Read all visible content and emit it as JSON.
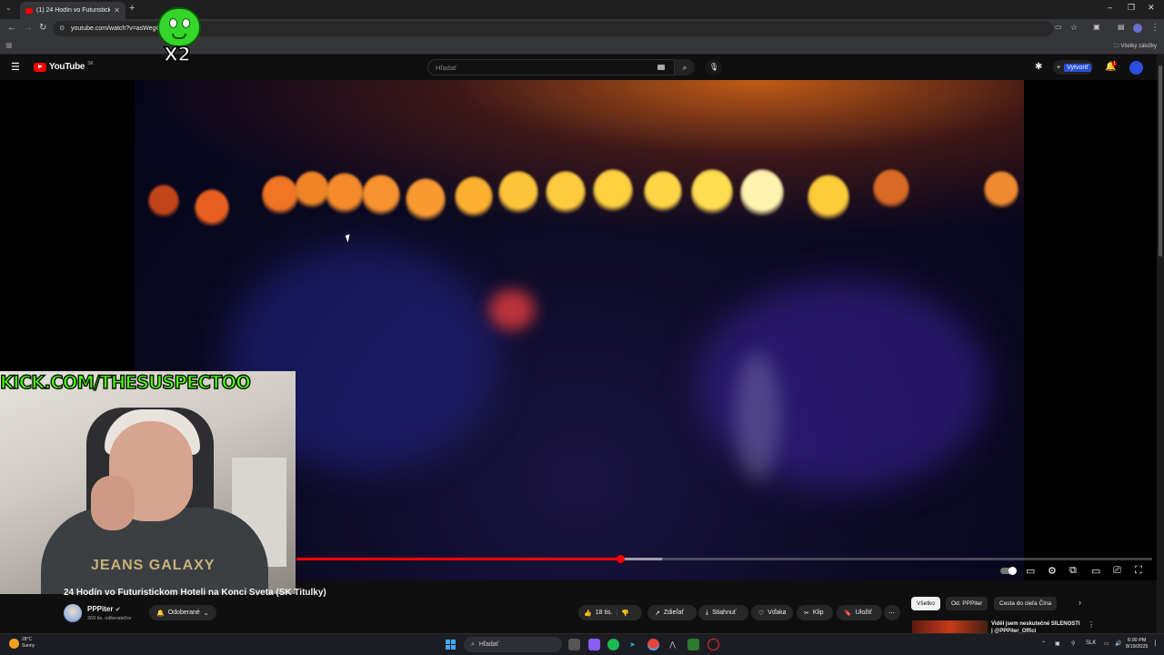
{
  "browser": {
    "tab_title": "(1) 24 Hodín vo Futuristickom H",
    "url": "youtube.com/watch?v=asWegG",
    "bookmarks_label": "Všetky záložky"
  },
  "youtube": {
    "logo_text": "YouTube",
    "country_code": "SK",
    "search_placeholder": "Hľadať",
    "create_label": "Vytvoriť",
    "notif_count": "1"
  },
  "overlay": {
    "kick_text": "KICK.COM/THESUSPECTOO",
    "multiplier": "X2",
    "shirt_text": "JEANS GALAXY"
  },
  "player": {
    "progress_fraction": 0.378,
    "buffered_fraction": 0.427
  },
  "video": {
    "title": "24 Hodín vo Futuristickom Hoteli na Konci Sveta (SK Titulky)",
    "channel_name": "PPPiter",
    "verified_icon": "verified-icon",
    "subscribers": "269 tis. odberateľov",
    "subscribed_label": "Odoberané",
    "like_count": "18 tis.",
    "share_label": "Zdieľať",
    "download_label": "Stiahnuť",
    "thanks_label": "Vďaka",
    "clip_label": "Klip",
    "save_label": "Uložiť"
  },
  "chips": [
    "Všetko",
    "Od: PPPiter",
    "Cesta do cieľa Čína"
  ],
  "recommended": {
    "title": "Viděl jsem neskutečné ŠÍLENOSTI | @PPPiter_Offici"
  },
  "taskbar": {
    "weather_temp": "28°C",
    "weather_desc": "Sunny",
    "search_placeholder": "Hľadať",
    "language": "SLK",
    "time": "6:00 PM",
    "date": "8/19/2025"
  },
  "colors": {
    "accent_red": "#ff0000",
    "kick_green": "#53fc18",
    "create_blue": "#2a4fd6"
  }
}
